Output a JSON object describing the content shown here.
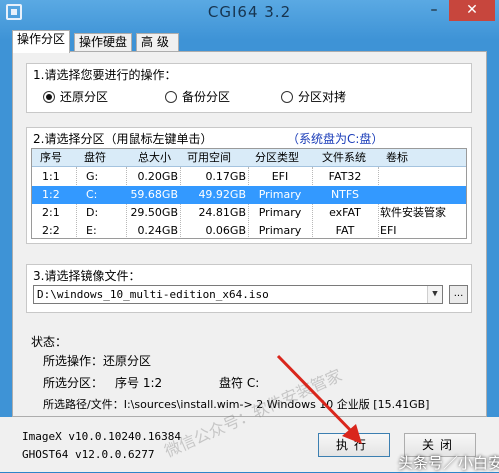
{
  "window": {
    "title": "CGI64  3.2"
  },
  "tabs": [
    {
      "label": "操作分区"
    },
    {
      "label": "操作硬盘"
    },
    {
      "label": "高 级"
    }
  ],
  "section1": {
    "title": "1.请选择您要进行的操作：",
    "options": [
      {
        "label": "还原分区",
        "checked": true
      },
      {
        "label": "备份分区",
        "checked": false
      },
      {
        "label": "分区对拷",
        "checked": false
      }
    ]
  },
  "section2": {
    "title": "2.请选择分区（用鼠标左键单击）",
    "system_disk": "（系统盘为C:盘）",
    "columns": [
      "序号",
      "盘符",
      "总大小",
      "可用空间",
      "分区类型",
      "文件系统",
      "卷标"
    ],
    "rows": [
      {
        "cells": [
          "1:1",
          "G:",
          "0.20GB",
          "0.17GB",
          "EFI",
          "FAT32",
          ""
        ],
        "selected": false
      },
      {
        "cells": [
          "1:2",
          "C:",
          "59.68GB",
          "49.92GB",
          "Primary",
          "NTFS",
          ""
        ],
        "selected": true
      },
      {
        "cells": [
          "2:1",
          "D:",
          "29.50GB",
          "24.81GB",
          "Primary",
          "exFAT",
          "软件安装管家"
        ],
        "selected": false
      },
      {
        "cells": [
          "2:2",
          "E:",
          "0.24GB",
          "0.06GB",
          "Primary",
          "FAT",
          "EFI"
        ],
        "selected": false
      }
    ]
  },
  "section3": {
    "title": "3.请选择镜像文件：",
    "image_path": "D:\\windows_10_multi-edition_x64.iso",
    "browse_label": "..."
  },
  "status": {
    "title": "状态：",
    "operation": "所选操作：还原分区",
    "partition_label": "所选分区：",
    "partition_index": "序号 1:2",
    "partition_drive": "盘符 C:",
    "path": "所选路径/文件：I:\\sources\\install.wim-> 2  Windows 10 企业版 [15.41GB]"
  },
  "footer": {
    "imagex": "ImageX v10.0.10240.16384",
    "ghost": "GHOST64 v12.0.0.6277",
    "execute_label": "执行",
    "close_label": "关闭"
  },
  "watermarks": {
    "diagonal": "微信公众号：软件安装管家",
    "corner": "头条号／小白安装"
  },
  "colors": {
    "selected_row": "#3399ff",
    "close_button": "#c7463d",
    "system_disk_text": "#1a3cb8"
  }
}
